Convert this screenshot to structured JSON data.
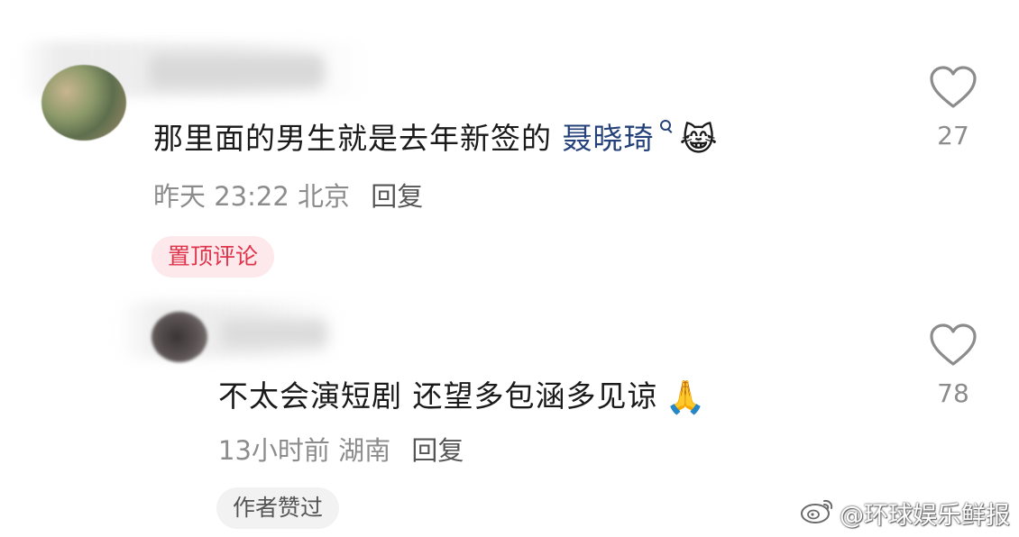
{
  "comments": [
    {
      "text_before_mention": "那里面的男生就是去年新签的 ",
      "mention": "聂晓琦",
      "emoji": "😹",
      "time": "昨天 23:22",
      "location": "北京",
      "reply_label": "回复",
      "badge": "置顶评论",
      "likes": "27"
    },
    {
      "text": "不太会演短剧 还望多包涵多见谅",
      "emoji": "🙏",
      "time": "13小时前",
      "location": "湖南",
      "reply_label": "回复",
      "badge": "作者赞过",
      "likes": "78"
    }
  ],
  "watermark": "@环球娱乐鲜报",
  "colors": {
    "mention": "#25417a",
    "pin_badge_bg": "#fde8ec",
    "pin_badge_text": "#e0344a",
    "meta_text": "#8c8c8c"
  },
  "icons": {
    "like": "heart-outline-icon",
    "mention_search": "search-icon",
    "watermark_logo": "weibo-icon"
  }
}
